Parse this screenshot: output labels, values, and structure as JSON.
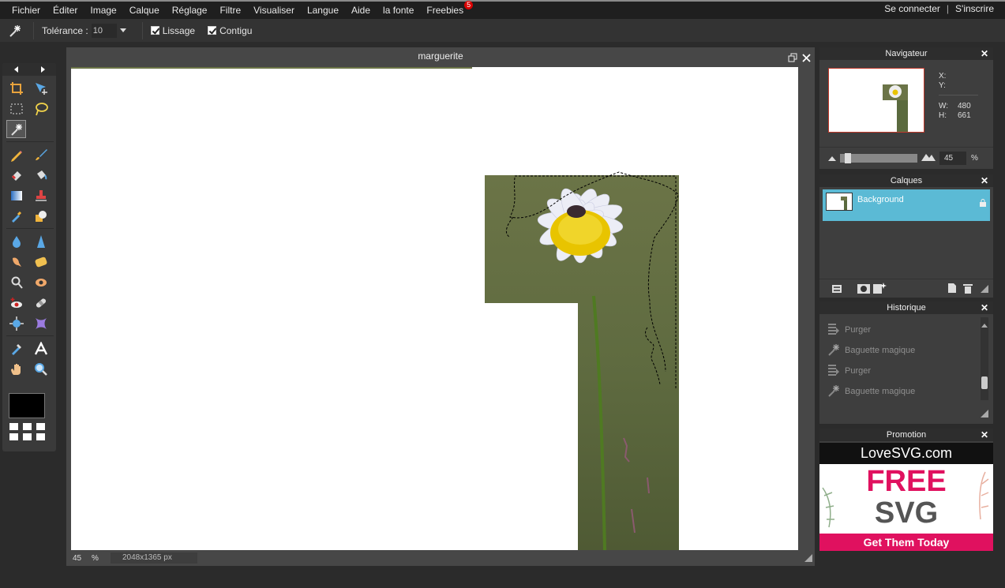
{
  "menu": {
    "items": [
      "Fichier",
      "Éditer",
      "Image",
      "Calque",
      "Réglage",
      "Filtre",
      "Visualiser",
      "Langue",
      "Aide",
      "la fonte",
      "Freebies"
    ],
    "freebies_badge": "5",
    "login": "Se connecter",
    "separator": "|",
    "signup": "S'inscrire"
  },
  "options": {
    "tolerance_label": "Tolérance :",
    "tolerance_value": "10",
    "smoothing_label": "Lissage",
    "smoothing_checked": true,
    "contiguous_label": "Contigu",
    "contiguous_checked": true
  },
  "tools": {
    "active": "magic-wand",
    "foreground_color": "#000000"
  },
  "document": {
    "title": "marguerite",
    "zoom": "45",
    "zoom_unit": "%",
    "dimensions": "2048x1365 px"
  },
  "navigator": {
    "title": "Navigateur",
    "x_label": "X:",
    "y_label": "Y:",
    "w_label": "W:",
    "w_value": "480",
    "h_label": "H:",
    "h_value": "661",
    "zoom_value": "45",
    "zoom_unit": "%"
  },
  "layers": {
    "title": "Calques",
    "items": [
      {
        "name": "Background",
        "locked": true
      }
    ]
  },
  "history": {
    "title": "Historique",
    "items": [
      {
        "label": "Purger",
        "icon": "purge-icon"
      },
      {
        "label": "Baguette magique",
        "icon": "magic-wand-icon"
      },
      {
        "label": "Purger",
        "icon": "purge-icon"
      },
      {
        "label": "Baguette magique",
        "icon": "magic-wand-icon"
      }
    ]
  },
  "promo": {
    "title": "Promotion",
    "brand": "LoveSVG.com",
    "line1": "FREE",
    "line2": "SVG",
    "cta": "Get Them Today"
  },
  "colors": {
    "accent": "#5bbad5",
    "ad_pink": "#e0115f"
  }
}
